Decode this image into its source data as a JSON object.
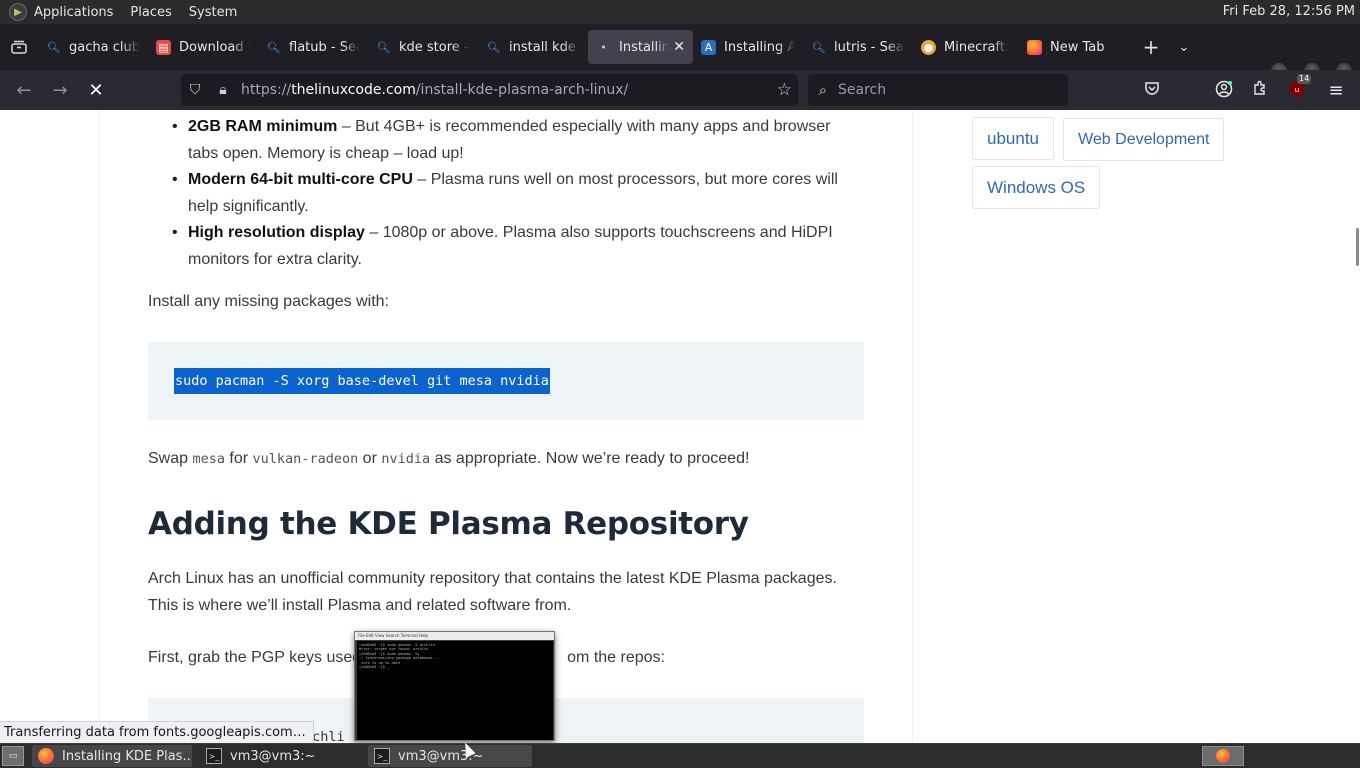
{
  "top_panel": {
    "menus": [
      "Applications",
      "Places",
      "System"
    ],
    "clock": "Fri Feb 28, 12:56 PM"
  },
  "tabs": [
    {
      "title": "gacha club",
      "icon": "search-icon",
      "active": false
    },
    {
      "title": "Download G",
      "icon": "store-icon",
      "active": false
    },
    {
      "title": "flatub - Sea",
      "icon": "search-icon",
      "active": false
    },
    {
      "title": "kde store -",
      "icon": "search-icon",
      "active": false
    },
    {
      "title": "install kde p",
      "icon": "search-icon",
      "active": false
    },
    {
      "title": "Installing",
      "icon": "loading-icon",
      "active": true
    },
    {
      "title": "Installing A",
      "icon": "site-a-icon",
      "active": false
    },
    {
      "title": "lutris - Sear",
      "icon": "search-icon",
      "active": false
    },
    {
      "title": "Minecraft:",
      "icon": "minecraft-icon",
      "active": false
    },
    {
      "title": "New Tab",
      "icon": "firefox-icon",
      "active": false
    }
  ],
  "navbar": {
    "url_prefix": "https://",
    "url_host": "thelinuxcode.com",
    "url_path": "/install-kde-plasma-arch-linux/",
    "search_placeholder": "Search",
    "extension_badge": "14"
  },
  "article": {
    "requirements": [
      {
        "bold": "2GB RAM minimum",
        "text": " – But 4GB+ is recommended especially with many apps and browser tabs open. Memory is cheap – load up!"
      },
      {
        "bold": "Modern 64-bit multi-core CPU",
        "text": " – Plasma runs well on most processors, but more cores will help significantly."
      },
      {
        "bold": "High resolution display",
        "text": " – 1080p or above. Plasma also supports touchscreens and HiDPI monitors for extra clarity."
      }
    ],
    "install_intro": "Install any missing packages with:",
    "code_install": "sudo pacman -S xorg base-devel git mesa nvidia",
    "swap_text": {
      "p1": "Swap ",
      "c1": "mesa",
      "p2": " for ",
      "c2": "vulkan-radeon",
      "p3": " or ",
      "c3": "nvidia",
      "p4": " as appropriate. Now we’re ready to proceed!"
    },
    "heading": "Adding the KDE Plasma Repository",
    "repo_text": "Arch Linux has an unofficial community repository that contains the latest KDE Plasma packages. This is where we’ll install Plasma and related software from.",
    "pgp_text_start": "First, grab the PGP keys used",
    "pgp_text_end": "om the repos:",
    "code_keys_partial": "sudo pacman -S archli"
  },
  "sidebar_tags": [
    "ubuntu",
    "Web Development",
    "Windows OS"
  ],
  "status_text": "Transferring data from fonts.googleapis.com…",
  "terminal_preview": {
    "menu": "File  Edit  View  Search  Terminal  Help",
    "lines": "[vm3@vm3 ~]$ sudo pacman -S archlin\nerror: target not found: archlin\n[vm3@vm3 ~]$ sudo pacman -Sy\n:: Synchronizing package databases...\n core is up to date\n[vm3@vm3 ~]$ _"
  },
  "taskbar": {
    "items": [
      {
        "label": "Installing KDE Plas...",
        "icon": "firefox-icon",
        "active": true
      },
      {
        "label": "vm3@vm3:~",
        "icon": "terminal-icon",
        "active": false
      },
      {
        "label": "vm3@vm3:~",
        "icon": "terminal-icon",
        "active": false
      }
    ]
  }
}
